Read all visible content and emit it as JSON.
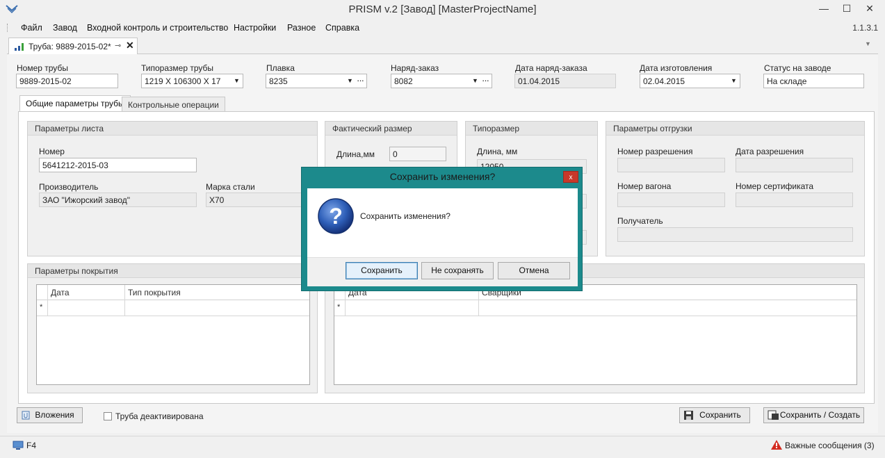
{
  "window": {
    "title": "PRISM v.2 [Завод] [MasterProjectName]",
    "minimize": "—",
    "maximize": "☐",
    "close": "✕"
  },
  "menu": {
    "items": [
      "Файл",
      "Завод",
      "Входной контроль и строительство",
      "Настройки",
      "Разное",
      "Справка"
    ],
    "version": "1.1.3.1"
  },
  "doc_tab": {
    "label": "Труба: 9889-2015-02*"
  },
  "header_fields": {
    "pipe_number": {
      "label": "Номер трубы",
      "value": "9889-2015-02"
    },
    "pipe_size": {
      "label": "Типоразмер трубы",
      "value": "1219 X 106300 X 17"
    },
    "heat": {
      "label": "Плавка",
      "value": "8235"
    },
    "work_order": {
      "label": "Наряд-заказ",
      "value": "8082"
    },
    "work_order_date": {
      "label": "Дата наряд-заказа",
      "value": "01.04.2015"
    },
    "manufacture_date": {
      "label": "Дата изготовления",
      "value": "02.04.2015"
    },
    "factory_status": {
      "label": "Статус на заводе",
      "value": "На складе"
    }
  },
  "subtabs": [
    "Общие параметры трубы",
    "Контрольные операции"
  ],
  "sheet_params": {
    "title": "Параметры листа",
    "number_label": "Номер",
    "number_value": "5641212-2015-03",
    "manufacturer_label": "Производитель",
    "manufacturer_value": "ЗАО \"Ижорский завод\"",
    "steel_grade_label": "Марка стали",
    "steel_grade_value": "X70"
  },
  "actual_size": {
    "title": "Фактический размер",
    "length_label": "Длина,мм",
    "length_value": "0"
  },
  "standard_size": {
    "title": "Типоразмер",
    "length_label": "Длина, мм",
    "length_value": "12050"
  },
  "shipping": {
    "title": "Параметры отгрузки",
    "permit_number": "Номер разрешения",
    "permit_date": "Дата разрешения",
    "wagon_number": "Номер вагона",
    "certificate_number": "Номер сертификата",
    "recipient": "Получатель"
  },
  "coating": {
    "title": "Параметры покрытия",
    "columns": [
      "Дата",
      "Тип покрытия"
    ],
    "new_row_marker": "*"
  },
  "welding": {
    "columns": [
      "Дата",
      "Сварщики"
    ],
    "new_row_marker": "*"
  },
  "bottom": {
    "attachments": "Вложения",
    "deactivated": "Труба деактивирована",
    "save": "Сохранить",
    "save_create": "Сохранить / Создать"
  },
  "dialog": {
    "title": "Сохранить изменения?",
    "message": "Сохранить изменения?",
    "icon": "question-icon",
    "buttons": {
      "save": "Сохранить",
      "dont_save": "Не сохранять",
      "cancel": "Отмена"
    },
    "close": "x"
  },
  "status": {
    "hotkey": "F4",
    "messages": "Важные сообщения (3)"
  },
  "colors": {
    "dialog_frame": "#1c8a8c",
    "close_red": "#c8382a",
    "question_blue": "#2e5fb8"
  }
}
